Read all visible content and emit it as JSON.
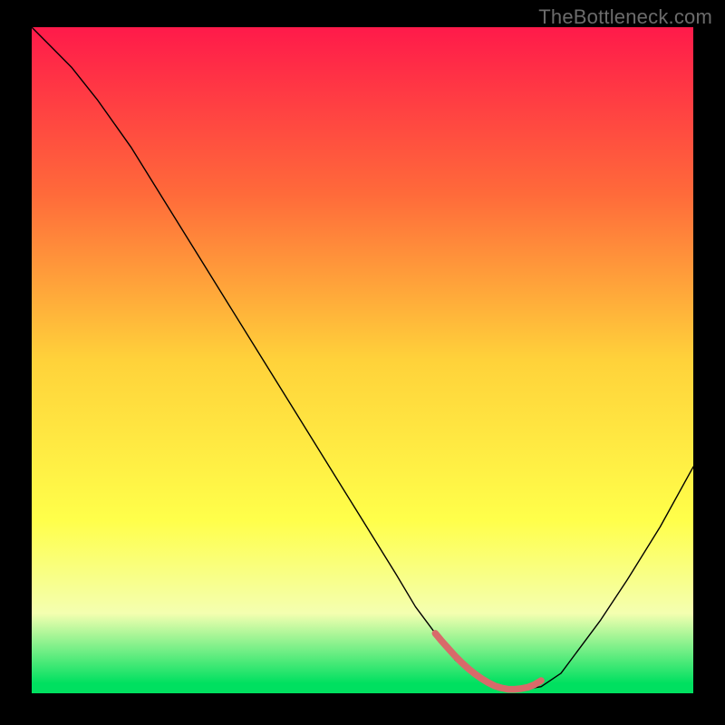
{
  "watermark": "TheBottleneck.com",
  "chart_data": {
    "type": "line",
    "title": "",
    "xlabel": "",
    "ylabel": "",
    "xlim": [
      0,
      100
    ],
    "ylim": [
      0,
      100
    ],
    "background_gradient": {
      "stops": [
        {
          "offset": 0.0,
          "color": "#ff1a4a"
        },
        {
          "offset": 0.25,
          "color": "#ff6a3a"
        },
        {
          "offset": 0.5,
          "color": "#ffd23a"
        },
        {
          "offset": 0.74,
          "color": "#ffff4a"
        },
        {
          "offset": 0.88,
          "color": "#f4ffb0"
        },
        {
          "offset": 0.985,
          "color": "#00e060"
        }
      ]
    },
    "series": [
      {
        "name": "bottleneck-curve",
        "color": "#000000",
        "width": 1.4,
        "x": [
          0,
          3,
          6,
          10,
          15,
          20,
          25,
          30,
          35,
          40,
          45,
          50,
          55,
          58,
          61,
          64,
          67,
          70,
          72,
          74,
          77,
          80,
          83,
          86,
          90,
          95,
          100
        ],
        "y": [
          100,
          97,
          94,
          89,
          82,
          74,
          66,
          58,
          50,
          42,
          34,
          26,
          18,
          13,
          9,
          5,
          2.5,
          1,
          0.5,
          0.5,
          1,
          3,
          7,
          11,
          17,
          25,
          34
        ]
      },
      {
        "name": "highlight-band",
        "color": "#d86a6a",
        "width": 7.5,
        "x": [
          61,
          62,
          63,
          64,
          65,
          66,
          67,
          68,
          69,
          70,
          71,
          72,
          73,
          74,
          75,
          76,
          77
        ],
        "y": [
          9,
          7.8,
          6.7,
          5.6,
          4.6,
          3.7,
          2.9,
          2.2,
          1.6,
          1.1,
          0.8,
          0.6,
          0.6,
          0.7,
          0.9,
          1.3,
          1.9
        ]
      }
    ]
  }
}
